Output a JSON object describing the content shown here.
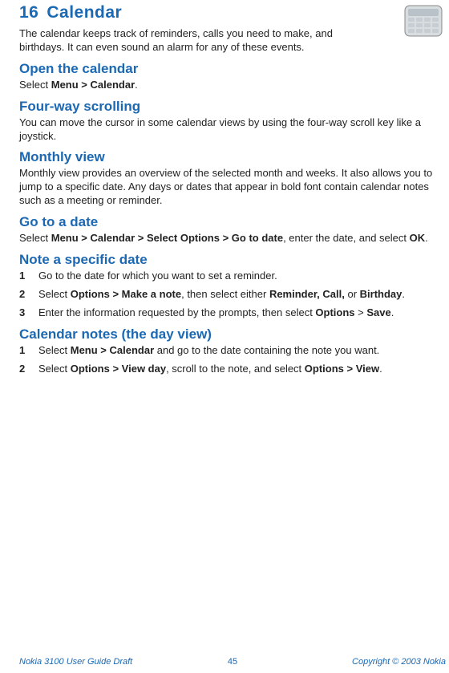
{
  "chapter": {
    "number": "16",
    "title": "Calendar"
  },
  "intro": "The calendar keeps track of reminders, calls you need to make, and birthdays. It can even sound an alarm for any of these events.",
  "sections": {
    "open": {
      "heading": "Open the calendar",
      "body_pre": "Select ",
      "body_bold": "Menu > Calendar",
      "body_post": "."
    },
    "fourway": {
      "heading": "Four-way scrolling",
      "body": "You can move the cursor in some calendar views by using the four-way scroll key like a joystick."
    },
    "monthly": {
      "heading": "Monthly view",
      "body": "Monthly view provides an overview of the selected month and weeks. It also allows you to jump to a specific date. Any days or dates that appear in bold font contain calendar notes such as a meeting or reminder."
    },
    "gotodate": {
      "heading": "Go to a date",
      "body_pre": "Select ",
      "body_bold1": "Menu > Calendar > Select Options > Go to date",
      "body_mid": ", enter the date, and select ",
      "body_bold2": "OK",
      "body_post": "."
    },
    "notedate": {
      "heading": "Note a specific date",
      "steps": [
        {
          "n": "1",
          "pre": "Go to the date for which you want to set a reminder.",
          "b1": "",
          "mid": "",
          "b2": "",
          "post": ""
        },
        {
          "n": "2",
          "pre": "Select ",
          "b1": "Options > Make a note",
          "mid": ", then select either ",
          "b2": "Reminder, Call,",
          "post": " or ",
          "b3": "Birthday",
          "tail": "."
        },
        {
          "n": "3",
          "pre": "Enter the information requested by the prompts, then select ",
          "b1": "Options",
          "mid": " > ",
          "b2": "Save",
          "post": ".",
          "b3": "",
          "tail": ""
        }
      ]
    },
    "dayview": {
      "heading": "Calendar notes (the day view)",
      "steps": [
        {
          "n": "1",
          "pre": "Select ",
          "b1": "Menu > Calendar",
          "mid": " and go to the date containing the note you want.",
          "b2": "",
          "post": ""
        },
        {
          "n": "2",
          "pre": "Select ",
          "b1": "Options > View day",
          "mid": ", scroll to the note, and select ",
          "b2": "Options > View",
          "post": "."
        }
      ]
    }
  },
  "footer": {
    "left": "Nokia 3100 User Guide Draft",
    "page": "45",
    "right": "Copyright © 2003 Nokia"
  },
  "icon_name": "calendar-icon"
}
